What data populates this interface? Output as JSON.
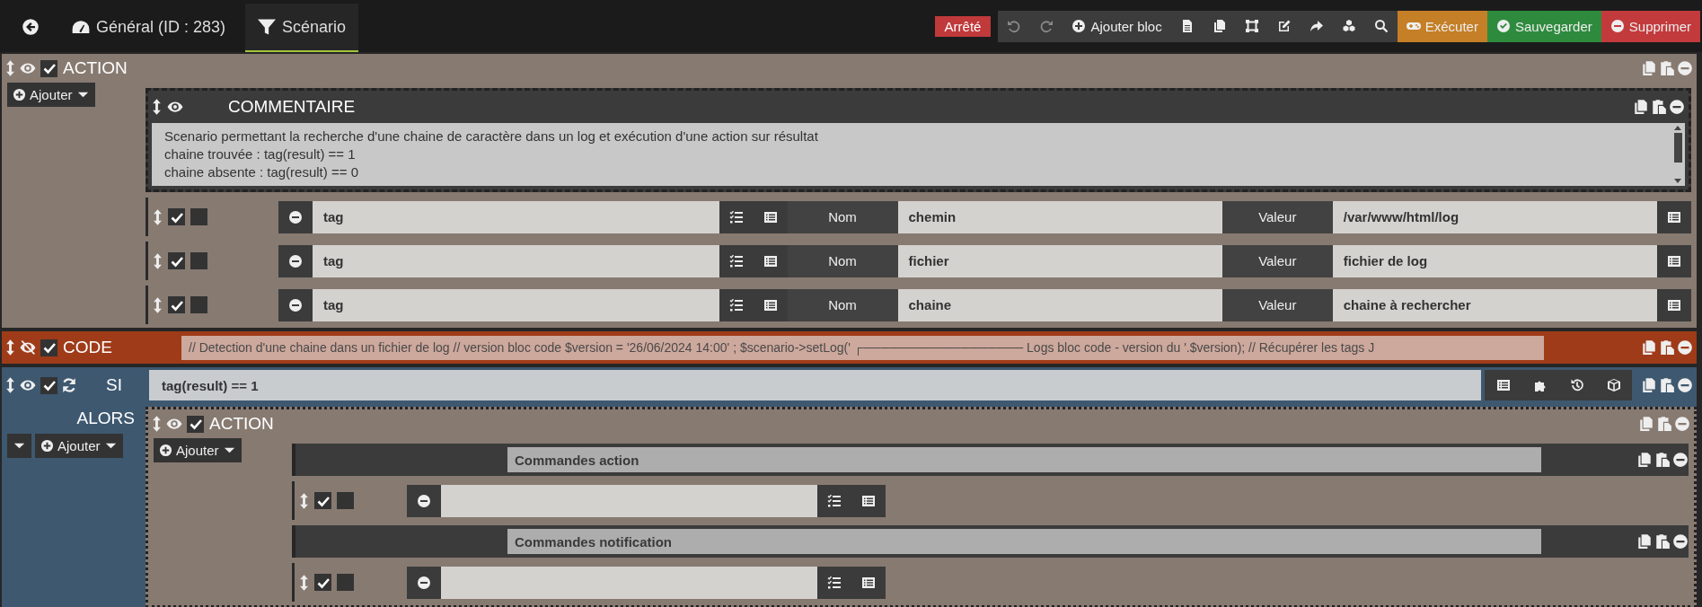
{
  "nav": {
    "tabs": [
      {
        "kind": "back",
        "selected": false
      },
      {
        "kind": "general",
        "label": "Général (ID : 283)",
        "selected": false
      },
      {
        "kind": "scenario",
        "label": "Scénario",
        "selected": true
      }
    ]
  },
  "status_badge": "Arrêté",
  "toolbar": [
    {
      "kind": "undo",
      "disabled": true
    },
    {
      "kind": "redo",
      "disabled": true
    },
    {
      "kind": "add",
      "label": "Ajouter bloc",
      "disabled": false
    },
    {
      "kind": "file",
      "disabled": false
    },
    {
      "kind": "copy",
      "disabled": false
    },
    {
      "kind": "frame",
      "disabled": false
    },
    {
      "kind": "edit",
      "disabled": false
    },
    {
      "kind": "share",
      "disabled": false
    },
    {
      "kind": "cubes",
      "disabled": false
    },
    {
      "kind": "search",
      "disabled": false
    },
    {
      "kind": "run",
      "label": "Exécuter",
      "disabled": false
    },
    {
      "kind": "save",
      "label": "Sauvegarder",
      "disabled": false
    },
    {
      "kind": "delete",
      "label": "Supprimer",
      "disabled": false
    }
  ],
  "blocks": [
    {
      "kind": "action",
      "title": "ACTION",
      "visible": true,
      "enabled": true,
      "add_label": "Ajouter",
      "elements": [
        {
          "kind": "comment",
          "title": "COMMENTAIRE",
          "visible": true,
          "lines": [
            "Scenario permettant la recherche d'une chaine de caractère dans un log et exécution d'une action sur résultat",
            "chaine trouvée : tag(result) == 1",
            "chaine absente : tag(result) == 0"
          ]
        },
        {
          "kind": "tag",
          "enabled": true,
          "option_checked": false,
          "command": "tag",
          "name_label": "Nom",
          "name": "chemin",
          "value_label": "Valeur",
          "value": "/var/www/html/log"
        },
        {
          "kind": "tag",
          "enabled": true,
          "option_checked": false,
          "command": "tag",
          "name_label": "Nom",
          "name": "fichier",
          "value_label": "Valeur",
          "value": "fichier de log"
        },
        {
          "kind": "tag",
          "enabled": true,
          "option_checked": false,
          "command": "tag",
          "name_label": "Nom",
          "name": "chaine",
          "value_label": "Valeur",
          "value": "chaine à rechercher"
        }
      ]
    },
    {
      "kind": "code",
      "title": "CODE",
      "visible": false,
      "enabled": true,
      "code": "// Detection d'une chaine dans un fichier de log // version bloc code $version = '26/06/2024 14:00' ; $scenario->setLog(' ┌────────────────── Logs bloc code - version du '.$version); // Récupérer les tags J"
    },
    {
      "kind": "if",
      "title": "SI",
      "visible": true,
      "enabled": true,
      "condition": "tag(result) == 1",
      "then_label": "ALORS",
      "add_label": "Ajouter",
      "then": [
        {
          "kind": "action",
          "title": "ACTION",
          "visible": true,
          "enabled": true,
          "add_label": "Ajouter",
          "elements": [
            {
              "kind": "group",
              "title": "Commandes action"
            },
            {
              "kind": "command",
              "enabled": true,
              "option_checked": false
            },
            {
              "kind": "group",
              "title": "Commandes notification"
            },
            {
              "kind": "command",
              "enabled": true,
              "option_checked": false
            }
          ]
        }
      ]
    }
  ]
}
